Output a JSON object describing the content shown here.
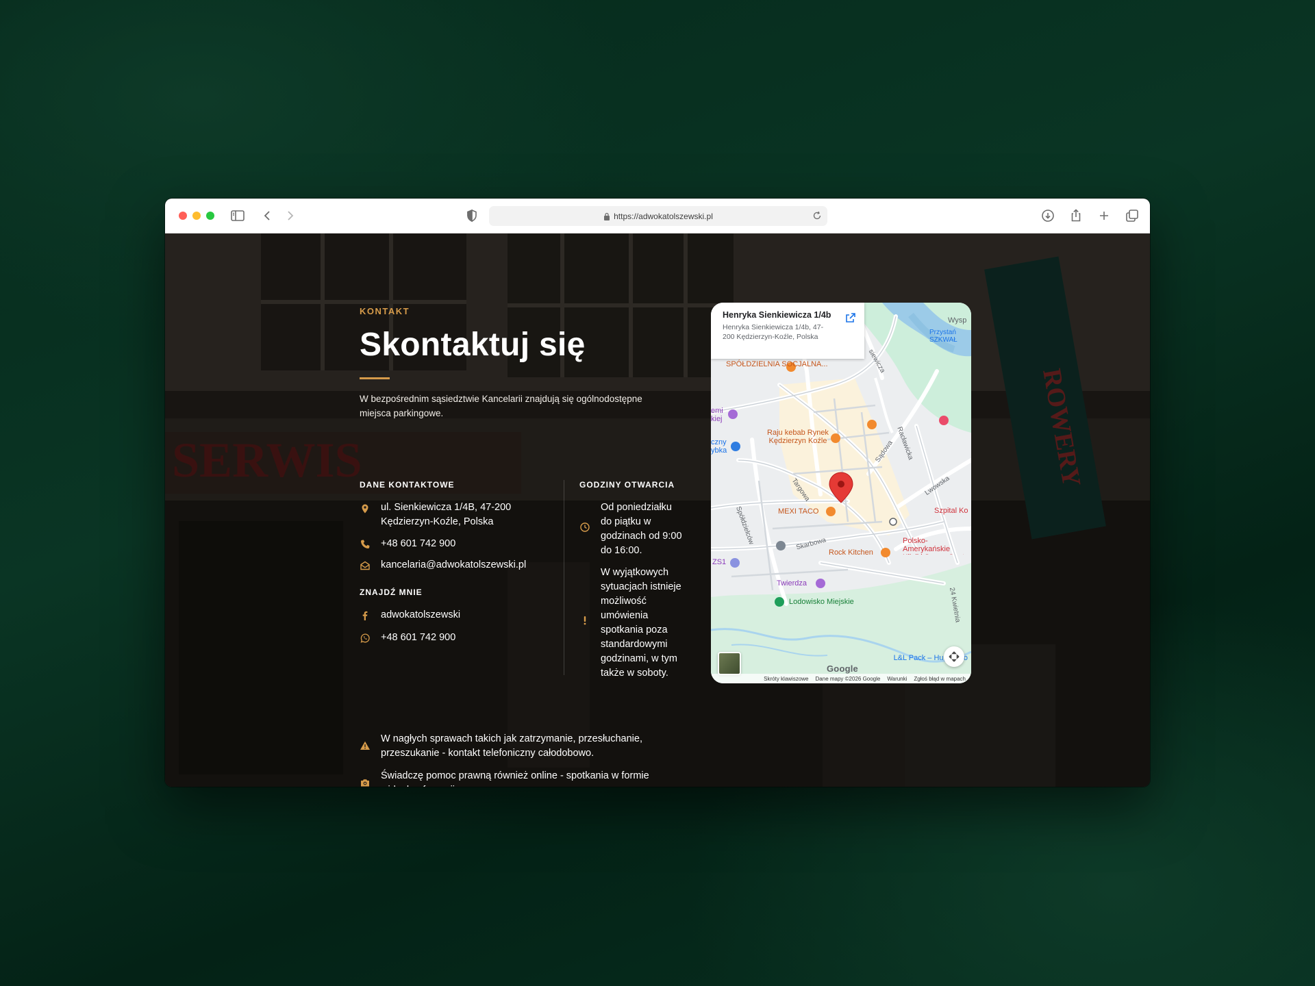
{
  "browser": {
    "url": "https://adwokatolszewski.pl"
  },
  "contact": {
    "eyebrow": "KONTAKT",
    "title": "Skontaktuj się",
    "intro": "W bezpośrednim sąsiedztwie Kancelarii znajdują się ogólnodostępne miejsca parkingowe.",
    "contact_heading": "DANE KONTAKTOWE",
    "address": "ul. Sienkiewicza 1/4B, 47-200 Kędzierzyn-Koźle, Polska",
    "phone": "+48 601 742 900",
    "email": "kancelaria@adwokatolszewski.pl",
    "find_heading": "ZNAJDŹ MNIE",
    "facebook": "adwokatolszewski",
    "whatsapp": "+48 601 742 900",
    "hours_heading": "GODZINY OTWARCIA",
    "hours": "Od poniedziałku do piątku w godzinach od 9:00 do 16:00.",
    "exceptional": "W wyjątkowych sytuacjach istnieje możliwość umówienia spotkania poza standardowymi godzinami, w tym także w soboty.",
    "urgent": "W nagłych sprawach takich jak zatrzymanie, przesłuchanie, przeszukanie - kontakt telefoniczny całodobowo.",
    "online": "Świadczę pomoc prawną również online - spotkania w formie wideokonferencji."
  },
  "map": {
    "card_title": "Henryka Sienkiewicza 1/4b",
    "card_address": "Henryka Sienkiewicza 1/4b, 47-200 Kędzierzyn-Koźle, Polska",
    "labels": {
      "spoldzielnia": "SPÓŁDZIELNIA SOCJALNA...",
      "raju": "Raju kebab Rynek Kędzierzyn Koźle",
      "mexi": "MEXI TACO",
      "rock": "Rock Kitchen",
      "twierdza": "Twierdza",
      "lodowisko": "Lodowisko Miejskie",
      "polsko": "Polsko-Amerykańskie Kliniki Serca, Cent",
      "szpital": "Szpital Ko",
      "przystan": "Przystań SZKWAŁ",
      "wysp": "Wysp",
      "lpack": "L&L Pack – Hu Opako",
      "zs1": "ZS1",
      "emi": "emi kiej",
      "czny": "czny ybka"
    },
    "streets": {
      "sienkiewicza": "siewicza",
      "raclawicka": "Racławicka",
      "sadowa": "Sądowa",
      "lwowska": "Lwowska",
      "targowa": "Targowa",
      "spoldzielcow": "Spółdzielców",
      "skarbowa": "Skarbowa",
      "kwietnia": "24 Kwietnia"
    },
    "google": "Google",
    "footer": [
      "Skróty klawiszowe",
      "Dane mapy ©2026 Google",
      "Warunki",
      "Zgłoś błąd w mapach"
    ]
  },
  "colors": {
    "accent": "#d69b4a",
    "background": "#073020"
  }
}
